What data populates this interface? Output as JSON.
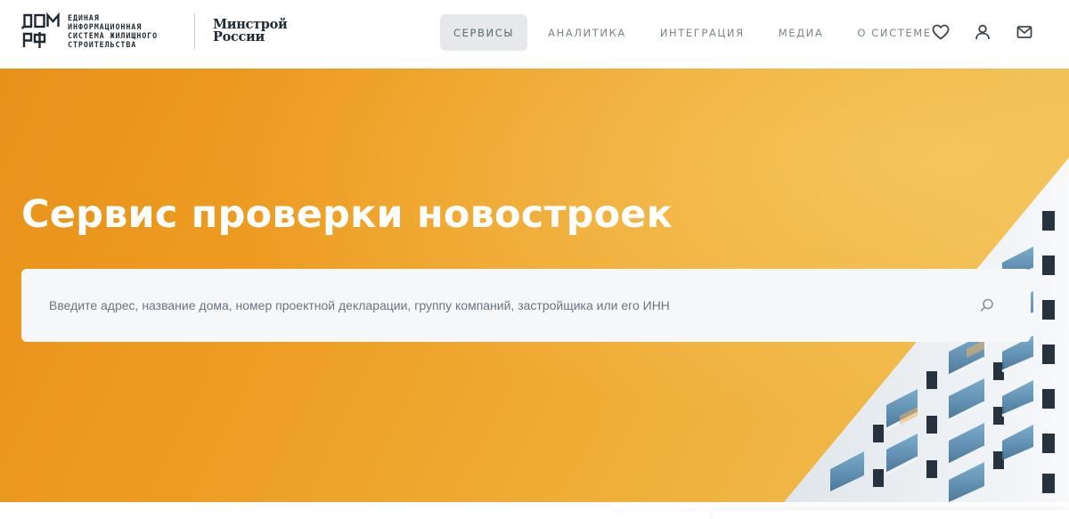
{
  "header": {
    "logo": {
      "mark_text": "ДОМ РФ",
      "lines": [
        "Единая",
        "информационная",
        "система жилищного",
        "строительства"
      ],
      "ministry_lines": [
        "Минстрой",
        "России"
      ]
    },
    "nav": [
      {
        "label": "СЕРВИСЫ",
        "active": true
      },
      {
        "label": "АНАЛИТИКА",
        "active": false
      },
      {
        "label": "ИНТЕГРАЦИЯ",
        "active": false
      },
      {
        "label": "МЕДИА",
        "active": false
      },
      {
        "label": "О СИСТЕМЕ",
        "active": false
      }
    ],
    "icons": [
      "heart-icon",
      "user-icon",
      "mail-icon"
    ]
  },
  "hero": {
    "title": "Сервис проверки новостроек",
    "search": {
      "placeholder": "Введите адрес, название дома, номер проектной декларации, группу компаний, застройщика или его ИНН",
      "value": "",
      "icon": "search-icon"
    }
  },
  "colors": {
    "hero_start": "#e8921a",
    "hero_end": "#f1bf52",
    "nav_active_bg": "#e6e8eb",
    "text_dark": "#1f2a33",
    "nav_text": "#7b858d"
  }
}
